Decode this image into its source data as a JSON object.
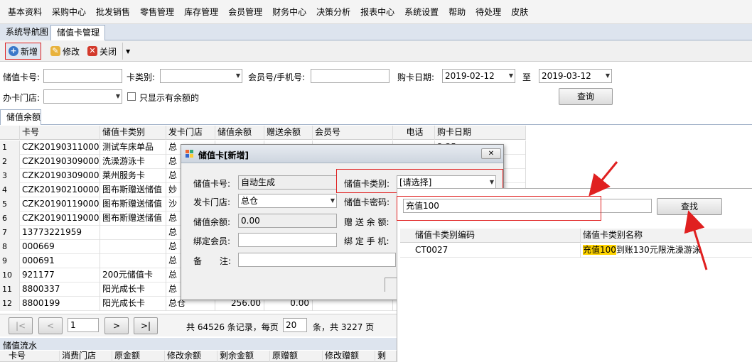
{
  "menu": [
    "基本资料",
    "采购中心",
    "批发销售",
    "零售管理",
    "库存管理",
    "会员管理",
    "财务中心",
    "决策分析",
    "报表中心",
    "系统设置",
    "帮助",
    "待处理",
    "皮肤"
  ],
  "tabs": [
    "系统导航图",
    "储值卡管理"
  ],
  "toolbar": {
    "add": "新增",
    "edit": "修改",
    "close": "关闭"
  },
  "filters": {
    "card_no_label": "储值卡号:",
    "card_type_label": "卡类别:",
    "member_label": "会员号/手机号:",
    "buy_date_label": "购卡日期:",
    "date_from": "2019-02-12",
    "to_label": "至",
    "date_to": "2019-03-12",
    "store_label": "办卡门店:",
    "only_balance_label": "只显示有余额的",
    "query_btn": "查询"
  },
  "balance_tab": "储值余额",
  "grid": {
    "headers": [
      "卡号",
      "储值卡类别",
      "发卡门店",
      "储值余额",
      "赠送余额",
      "会员号",
      "电话",
      "购卡日期"
    ],
    "rows": [
      {
        "idx": "1",
        "card": "CZK201903110001",
        "type": "测试车床单品",
        "store": "总",
        "date": "3:35"
      },
      {
        "idx": "2",
        "card": "CZK201903090002",
        "type": "洗澡游泳卡",
        "store": "总",
        "date": "6:39"
      },
      {
        "idx": "3",
        "card": "CZK201903090001",
        "type": "莱州服务卡",
        "store": "总",
        "date": "3:58"
      },
      {
        "idx": "4",
        "card": "CZK201902100001",
        "type": "图布斯赠送储值",
        "store": "妙"
      },
      {
        "idx": "5",
        "card": "CZK201901190002",
        "type": "图布斯赠送储值",
        "store": "沙"
      },
      {
        "idx": "6",
        "card": "CZK201901190001",
        "type": "图布斯赠送储值",
        "store": "总"
      },
      {
        "idx": "7",
        "card": "13773221959",
        "type": "",
        "store": "总"
      },
      {
        "idx": "8",
        "card": "000669",
        "type": "",
        "store": "总"
      },
      {
        "idx": "9",
        "card": "000691",
        "type": "",
        "store": "总"
      },
      {
        "idx": "10",
        "card": "921177",
        "type": "200元储值卡",
        "store": "总"
      },
      {
        "idx": "11",
        "card": "8800337",
        "type": "阳光成长卡",
        "store": "总"
      },
      {
        "idx": "12",
        "card": "8800199",
        "type": "阳光成长卡",
        "store": "总仓",
        "bal": "256.00",
        "gift": "0.00"
      }
    ]
  },
  "pager": {
    "first": "|<",
    "prev": "<",
    "page": "1",
    "next": ">",
    "last": ">|",
    "total_text": "共 64526 条记录，每页",
    "per_page": "20",
    "pages_text": "条，共 3227 页"
  },
  "flow": {
    "title": "储值流水",
    "headers": [
      "卡号",
      "消费门店",
      "原金额",
      "修改余额",
      "剩余金额",
      "原赠额",
      "修改赠额",
      "剩"
    ]
  },
  "dialog": {
    "title": "储值卡[新增]",
    "card_no_label": "储值卡号:",
    "card_no_value": "自动生成",
    "type_label": "储值卡类别:",
    "type_value": "[请选择]",
    "store_label": "发卡门店:",
    "store_value": "总仓",
    "pwd_label": "储值卡密码:",
    "balance_label": "储值余额:",
    "balance_value": "0.00",
    "gift_label": "赠 送 余 额:",
    "member_label": "绑定会员:",
    "phone_label": "绑 定 手 机:",
    "remark_label": "备",
    "remark_label2": "注:"
  },
  "popup": {
    "search_value": "充值100",
    "search_btn": "查找",
    "headers": [
      "储值卡类别编码",
      "储值卡类别名称"
    ],
    "rows": [
      {
        "code": "CT0027",
        "name_hl": "充值100",
        "name_rest": "到账130元限洗澡游泳"
      }
    ]
  },
  "colors": {
    "annotation": "#e02020",
    "highlight": "#ffd400"
  }
}
